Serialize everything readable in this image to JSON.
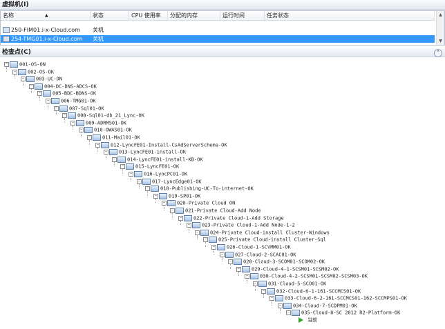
{
  "vm_section": {
    "title": "虚拟机(I)",
    "columns": [
      "名称",
      "状态",
      "CPU 使用率",
      "分配的内存",
      "运行时间",
      "任务状态"
    ],
    "rows": [
      {
        "name": "250-FIM01.i-x-Cloud.com",
        "status": "关机",
        "selected": false
      },
      {
        "name": "254-TMG01.i-x-Cloud.com",
        "status": "关机",
        "selected": true
      }
    ]
  },
  "checkpoint_section": {
    "title": "检查点(C)",
    "nodes": [
      "001-OS-ON",
      "002-OS-OK",
      "003-UC-ON",
      "004-DC-DNS-ADCS-OK",
      "005-BDC-BDNS-OK",
      "006-TMG01-OK",
      "007-Sql01-OK",
      "008-Sql01-db_21_Lync-OK",
      "009-ADRMS01-OK",
      "010-OWAS01-OK",
      "011-Mail01-OK",
      "012-LyncFE01-Install-CsAdServerSchema-OK",
      "013-LyncFE01-install-OK",
      "014-LyncFE01-install-KB-OK",
      "015-LyncFE01-OK",
      "016-LyncPC01-OK",
      "017-LyncEdge01-OK",
      "018-Publishing-UC-To-internet-OK",
      "019-SP01-OK",
      "020-Private Cloud ON",
      "021-Private Cloud-Add Node",
      "022-Private Cloud-1-Add Storage",
      "023-Private Cloud-1-Add Node-1-2",
      "024-Private Cloud-install Cluster-Windows",
      "025-Private Cloud-install Cluster-Sql",
      "026-Cloud-1-SCVMM01-OK",
      "027-Cloud-2-SCAC01-OK",
      "028-Cloud-3-SCOM01-SCOM02-OK",
      "029-Cloud-4-1-SCSM01-SCSM02-OK",
      "030-Cloud-4-2-SCSM01-SCSM02-SCSM03-OK",
      "031-Cloud-5-SCO01-OK",
      "032-Cloud-6-1-161-SCCMCS01-OK",
      "033-Cloud-6-2-161-SCCMCS01-162-SCCMPS01-OK",
      "034-Cloud-7-SCDPM01-OK",
      "035-Cloud-8-SC 2012 R2-Platform-OK"
    ],
    "current_label": "当前"
  }
}
